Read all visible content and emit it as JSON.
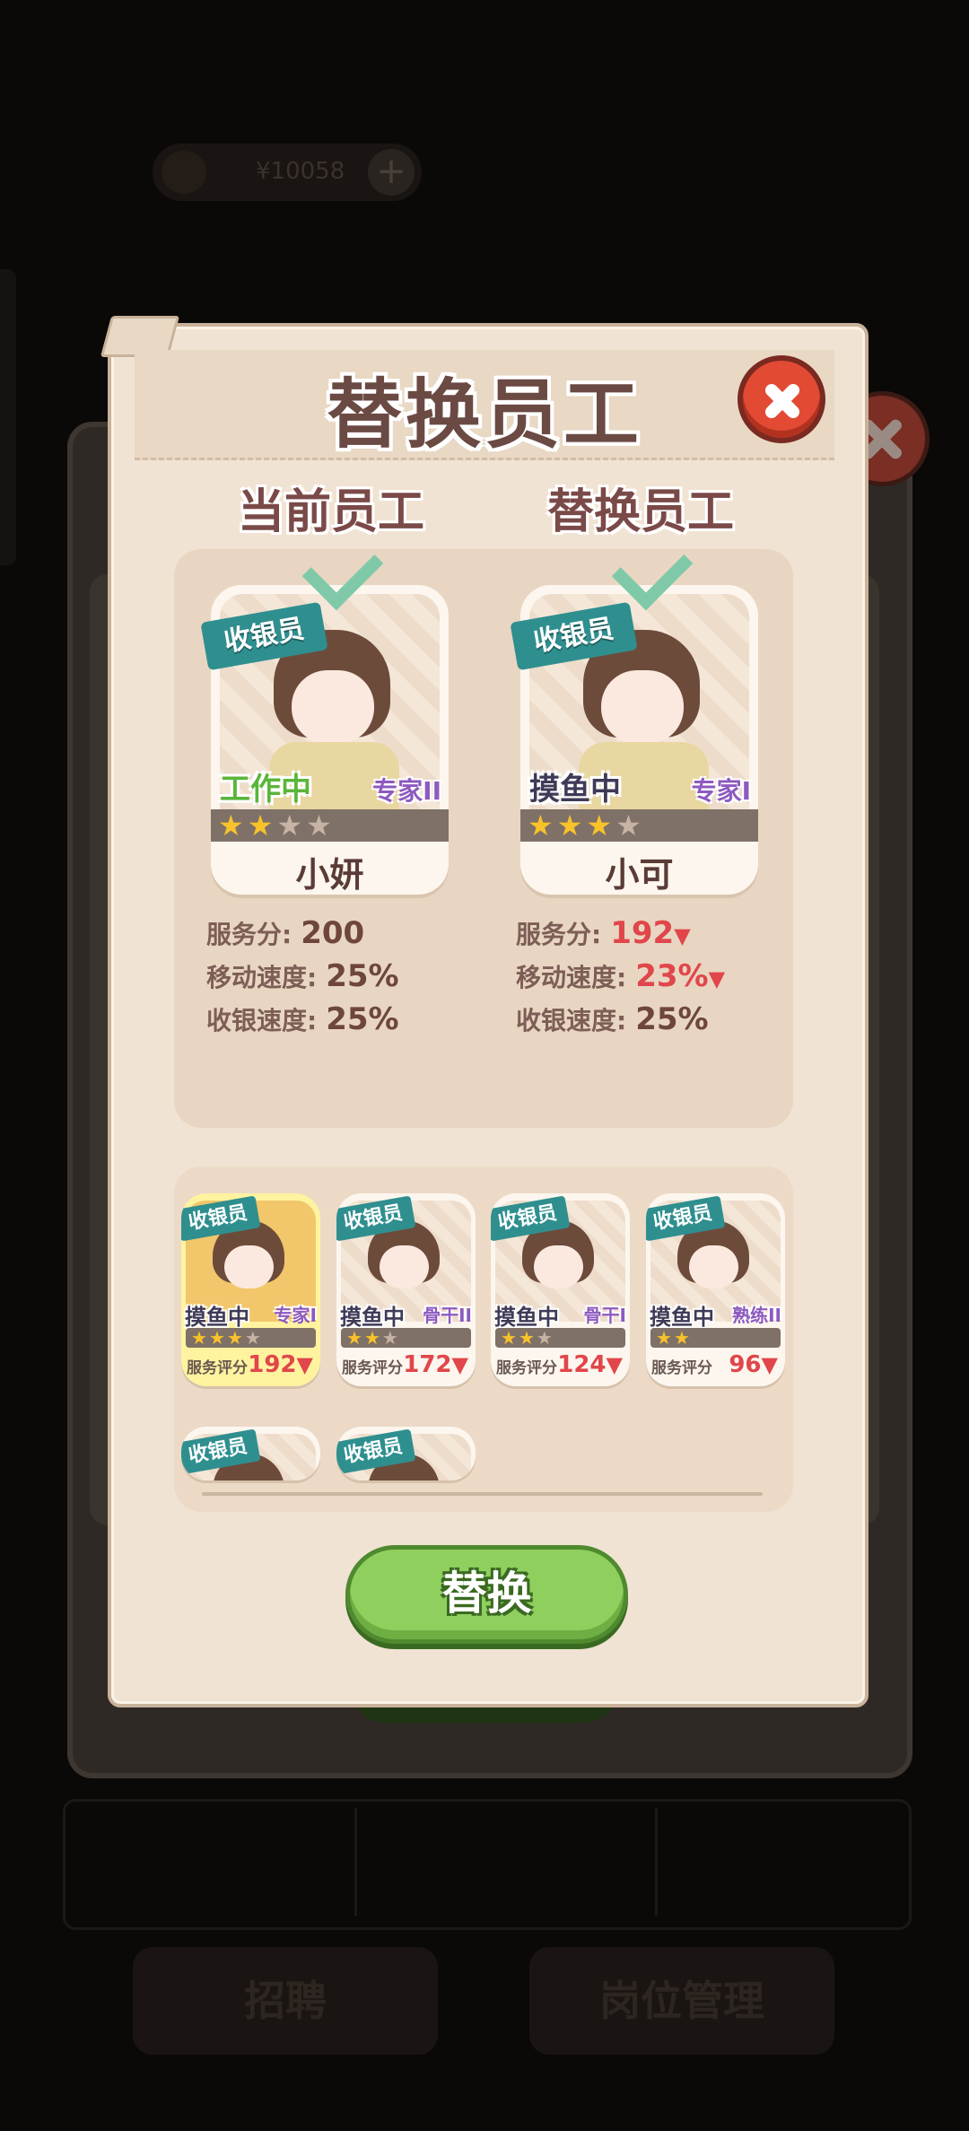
{
  "background": {
    "coin_amount": "¥10058",
    "bottom_buttons": [
      "招聘",
      "岗位管理"
    ]
  },
  "modal": {
    "title": "替换员工",
    "left_column_title": "当前员工",
    "right_column_title": "替换员工",
    "current": {
      "role": "收银员",
      "status": "工作中",
      "rank": "专家II",
      "stars": 2,
      "max_stars": 4,
      "name": "小妍",
      "stats": [
        {
          "label": "服务分:",
          "value": "200",
          "down": false
        },
        {
          "label": "移动速度:",
          "value": "25%",
          "down": false
        },
        {
          "label": "收银速度:",
          "value": "25%",
          "down": false
        }
      ]
    },
    "replacement": {
      "role": "收银员",
      "status": "摸鱼中",
      "rank": "专家I",
      "stars": 3,
      "max_stars": 4,
      "name": "小可",
      "stats": [
        {
          "label": "服务分:",
          "value": "192",
          "down": true
        },
        {
          "label": "移动速度:",
          "value": "23%",
          "down": true
        },
        {
          "label": "收银速度:",
          "value": "25%",
          "down": false
        }
      ]
    },
    "candidates": [
      {
        "role": "收银员",
        "status": "摸鱼中",
        "rank": "专家I",
        "stars": 3,
        "score_label": "服务评分",
        "score": "192",
        "selected": true
      },
      {
        "role": "收银员",
        "status": "摸鱼中",
        "rank": "骨干II",
        "stars": 2,
        "score_label": "服务评分",
        "score": "172",
        "selected": false
      },
      {
        "role": "收银员",
        "status": "摸鱼中",
        "rank": "骨干I",
        "stars": 2,
        "score_label": "服务评分",
        "score": "124",
        "selected": false
      },
      {
        "role": "收银员",
        "status": "摸鱼中",
        "rank": "熟练II",
        "stars": 2,
        "score_label": "服务评分",
        "score": "96",
        "selected": false
      },
      {
        "role": "收银员"
      },
      {
        "role": "收银员"
      }
    ],
    "replace_button": "替换"
  },
  "colors": {
    "parchment": "#f1e3d3",
    "close_red": "#e24a34",
    "replace_green": "#8fcf5e",
    "down_red": "#e0464a",
    "role_teal": "#2f8f8f"
  }
}
